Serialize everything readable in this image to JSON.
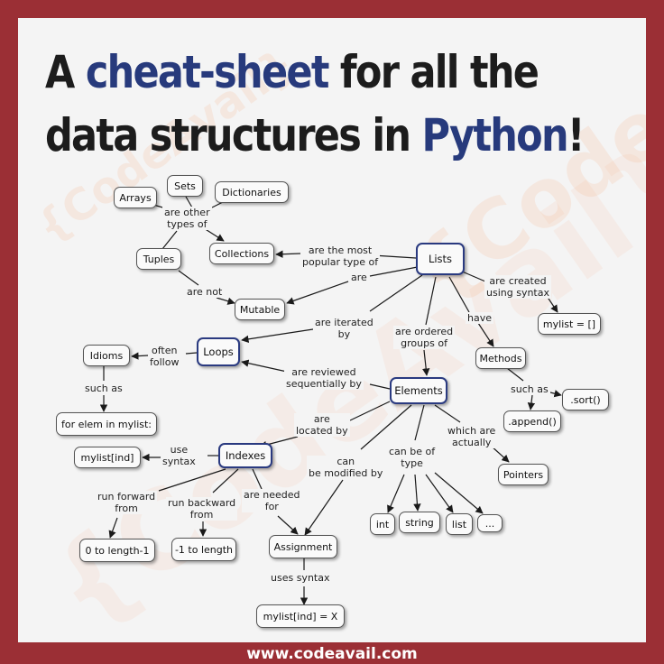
{
  "title": {
    "line1_a": "A ",
    "line1_b": "cheat-sheet",
    "line1_c": " for all the",
    "line2_a": "data structures in ",
    "line2_b": "Python",
    "line2_c": "!"
  },
  "watermark": {
    "small": "{CodeAvail}",
    "mid": "{CodeAvail}",
    "large": "{CodeAvail}"
  },
  "nodes": {
    "arrays": "Arrays",
    "sets": "Sets",
    "dictionaries": "Dictionaries",
    "tuples": "Tuples",
    "collections": "Collections",
    "lists": "Lists",
    "mutable": "Mutable",
    "mylist_empty": "mylist = []",
    "idioms": "Idioms",
    "loops": "Loops",
    "methods": "Methods",
    "elements": "Elements",
    "sort": ".sort()",
    "for_elem": "for elem in mylist:",
    "append": ".append()",
    "mylist_ind": "mylist[ind]",
    "indexes": "Indexes",
    "pointers": "Pointers",
    "int": "int",
    "string": "string",
    "list": "list",
    "ellipsis": "...",
    "zero_to_len": "0 to length-1",
    "neg_to_len": "-1 to length",
    "assignment": "Assignment",
    "mylist_assign": "mylist[ind] = X"
  },
  "labels": {
    "other_types": "are other\ntypes of",
    "most_popular": "are the most\npopular type of",
    "are": "are",
    "are_not": "are not",
    "created_syntax": "are created\nusing syntax",
    "have": "have",
    "iterated": "are iterated\nby",
    "ordered": "are ordered\ngroups of",
    "often_follow": "often\nfollow",
    "reviewed": "are reviewed\nsequentially by",
    "such_as_1": "such as",
    "such_as_2": "such as",
    "located": "are\nlocated by",
    "actually": "which are\nactually",
    "use_syntax": "use\nsyntax",
    "modified": "can\nbe modified by",
    "type": "can be of\ntype",
    "run_forward": "run forward\nfrom",
    "run_backward": "run backward\nfrom",
    "needed_for": "are needed\nfor",
    "uses_syntax": "uses syntax"
  },
  "footer": "www.codeavail.com",
  "colors": {
    "frame": "#9b2f35",
    "accent": "#273a7c",
    "key_border": "#2a3a80",
    "watermark": "#f5a57a"
  }
}
